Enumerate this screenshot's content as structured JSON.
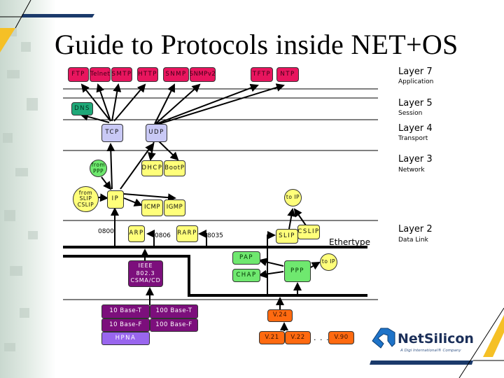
{
  "title": "Guide to Protocols inside NET+OS",
  "layers": [
    {
      "number": "Layer 7",
      "name": "Application"
    },
    {
      "number": "Layer 5",
      "name": "Session"
    },
    {
      "number": "Layer 4",
      "name": "Transport"
    },
    {
      "number": "Layer 3",
      "name": "Network"
    },
    {
      "number": "Layer 2",
      "name": "Data Link"
    }
  ],
  "application": [
    "FTP",
    "Telnet",
    "SMTP",
    "HTTP",
    "SNMP",
    "SNMPv2",
    "TFTP",
    "NTP"
  ],
  "session": {
    "dns": "DNS"
  },
  "transport": {
    "tcp": "TCP",
    "udp": "UDP"
  },
  "network": {
    "from_ppp": "from PPP",
    "from_slip": "from SLIP CSLIP",
    "ip": "IP",
    "dhcp": "DHCP",
    "bootp": "BootP",
    "icmp": "ICMP",
    "igmp": "IGMP",
    "to_ip_top": "to IP"
  },
  "datalink": {
    "ethertype_0800": "0800",
    "arp": "ARP",
    "ethertype_0806": "0806",
    "rarp": "RARP",
    "ethertype_8035": "8035",
    "slip": "SLIP",
    "cslip": "CSLIP",
    "ethertype_label": "Ethertype",
    "ieee": "IEEE 802.3 CSMA/CD",
    "pap": "PAP",
    "chap": "CHAP",
    "ppp": "PPP",
    "to_ip_ppp": "to IP"
  },
  "physical": {
    "eth": [
      "10 Base-T",
      "100 Base-T",
      "10 Base-F",
      "100 Base-F"
    ],
    "hpna": "HPNA",
    "v24": "V.24",
    "serial": [
      "V.21",
      "V.22",
      "V.90"
    ],
    "ellipsis": ". . ."
  },
  "logo": {
    "name": "NetSilicon",
    "tagline": "A Digi International® Company"
  },
  "colors": {
    "application": "#e8155e",
    "session": "#1fa878",
    "transport": "#c9c9f5",
    "network": "#ffff7a",
    "ppp": "#6fe86f",
    "ethernet": "#7c0f7c",
    "hpna": "#9966ee",
    "serial": "#ff6a10",
    "accent_navy": "#1b3a6b",
    "accent_gold": "#f5c026"
  }
}
